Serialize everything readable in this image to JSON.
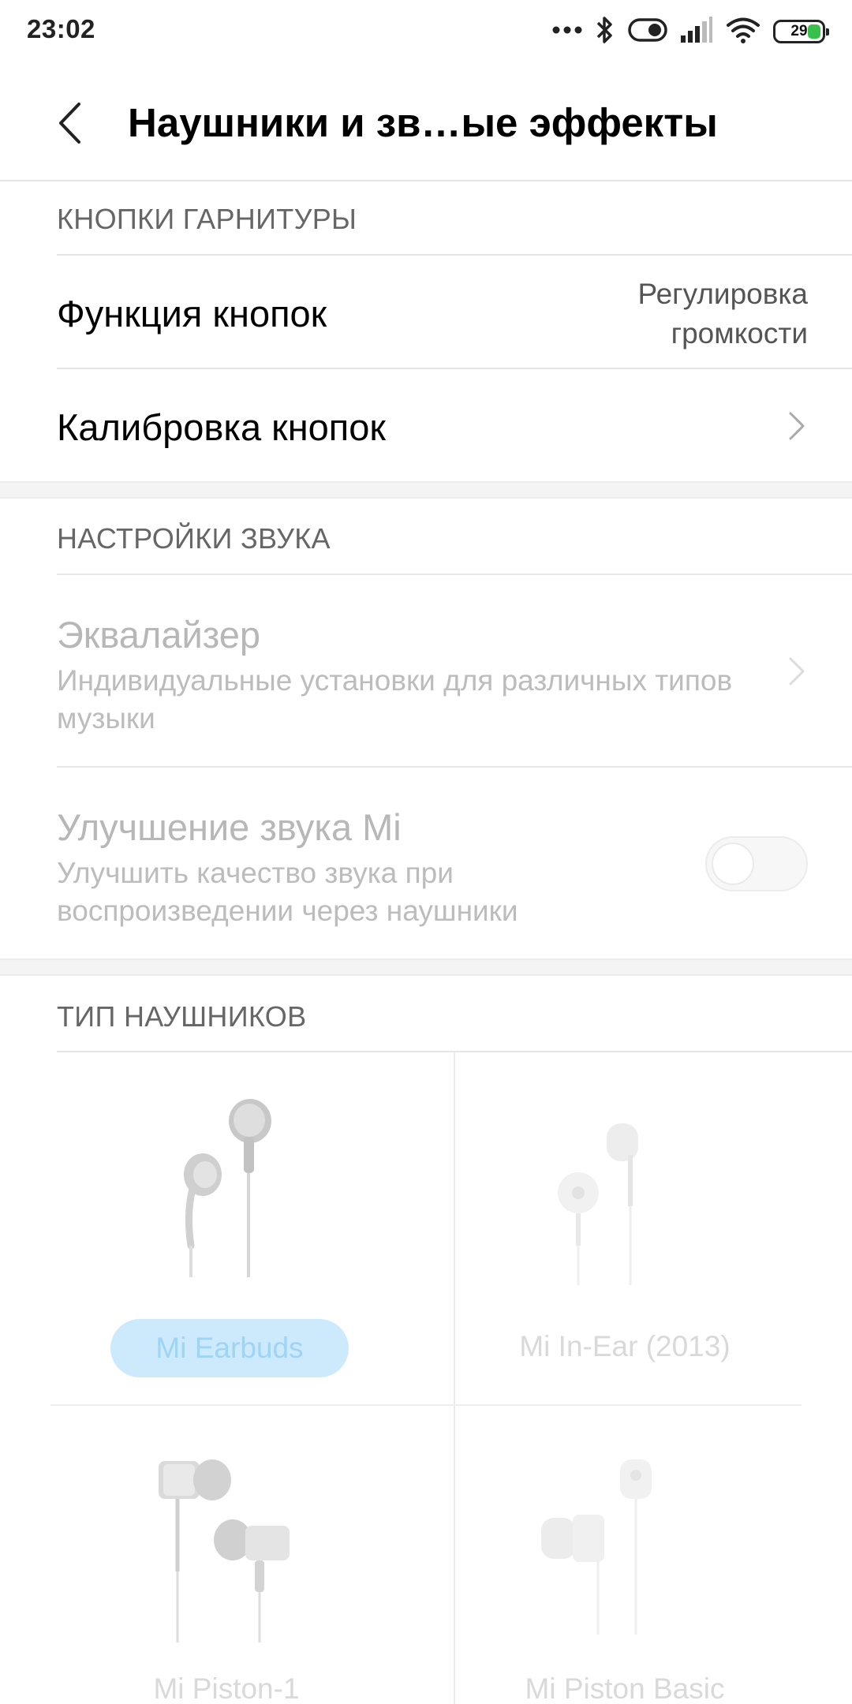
{
  "status_bar": {
    "time": "23:02",
    "battery_level": "29",
    "icons": [
      "more-dots-icon",
      "bluetooth-icon",
      "toggle-status-icon",
      "signal-icon",
      "wifi-icon",
      "battery-icon"
    ],
    "battery_color": "#39c04a"
  },
  "header": {
    "back_icon": "chevron-left-icon",
    "title": "Наушники и зв…ые эффекты"
  },
  "sections": {
    "headset_buttons": {
      "label": "КНОПКИ ГАРНИТУРЫ",
      "button_function": {
        "title": "Функция кнопок",
        "value_line1": "Регулировка",
        "value_line2": "громкости"
      },
      "button_calibration": {
        "title": "Калибровка кнопок"
      }
    },
    "sound_settings": {
      "label": "НАСТРОЙКИ ЗВУКА",
      "equalizer": {
        "title": "Эквалайзер",
        "subtitle": "Индивидуальные установки для различных типов музыки"
      },
      "mi_sound": {
        "title": "Улучшение звука Mi",
        "subtitle": "Улучшить качество звука при воспроизведении через наушники",
        "enabled": false
      }
    },
    "headphone_type": {
      "label": "ТИП НАУШНИКОВ",
      "items": [
        {
          "name": "Mi Earbuds",
          "selected": true
        },
        {
          "name": "Mi In-Ear (2013)",
          "selected": false
        },
        {
          "name": "Mi Piston-1",
          "selected": false
        },
        {
          "name": "Mi Piston Basic",
          "selected": false
        }
      ]
    }
  },
  "colors": {
    "selected_pill": "#cdeafd",
    "selected_text": "#9fd4f5",
    "disabled_text": "#b7b7b7"
  }
}
